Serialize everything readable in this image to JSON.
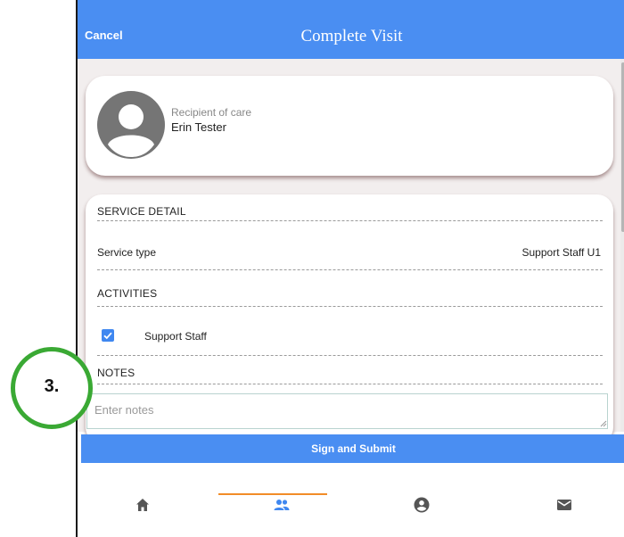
{
  "header": {
    "cancel_label": "Cancel",
    "title": "Complete Visit"
  },
  "recipient": {
    "label": "Recipient of care",
    "name": "Erin Tester",
    "avatar_icon": "avatar-icon"
  },
  "service_detail": {
    "heading": "SERVICE DETAIL",
    "service_type_label": "Service type",
    "service_type_value": "Support Staff U1"
  },
  "activities": {
    "heading": "ACTIVITIES",
    "items": [
      {
        "label": "Support Staff",
        "checked": true
      }
    ]
  },
  "notes": {
    "heading": "NOTES",
    "placeholder": "Enter notes",
    "value": ""
  },
  "submit_label": "Sign and Submit",
  "bottom_nav": {
    "items": [
      {
        "icon": "home-icon"
      },
      {
        "icon": "people-icon",
        "active": true
      },
      {
        "icon": "account-icon"
      },
      {
        "icon": "mail-icon"
      }
    ],
    "active_color": "#f28c28"
  },
  "callout": {
    "label": "3."
  },
  "colors": {
    "primary": "#4a8ef2",
    "callout_border": "#3aa934"
  }
}
